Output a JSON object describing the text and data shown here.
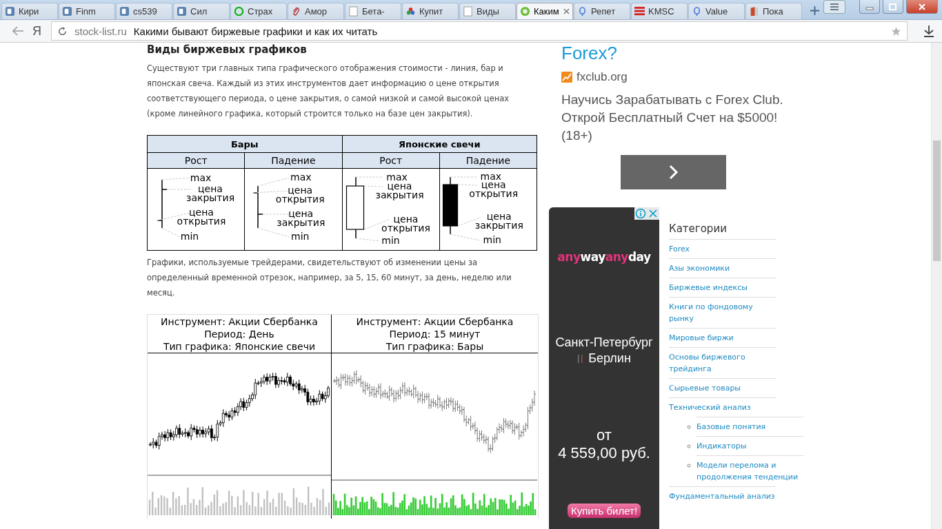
{
  "browser": {
    "tabs": [
      {
        "title": "Кири",
        "kind": "square",
        "selected": false
      },
      {
        "title": "Finm",
        "kind": "square",
        "selected": false
      },
      {
        "title": "cs539",
        "kind": "square",
        "selected": false
      },
      {
        "title": "Сил",
        "kind": "square",
        "selected": false
      },
      {
        "title": "Страх",
        "kind": "dollar",
        "selected": false
      },
      {
        "title": "Амор",
        "kind": "clip",
        "selected": false
      },
      {
        "title": "Бета-",
        "kind": "page",
        "selected": false
      },
      {
        "title": "Купит",
        "kind": "dots",
        "selected": false
      },
      {
        "title": "Виды",
        "kind": "page",
        "selected": false
      },
      {
        "title": "Каким",
        "kind": "coin",
        "selected": true
      },
      {
        "title": "Репет",
        "kind": "pin",
        "selected": false
      },
      {
        "title": "KMSC",
        "kind": "stripes",
        "selected": false
      },
      {
        "title": "Value",
        "kind": "pin",
        "selected": false
      },
      {
        "title": "Пока",
        "kind": "book",
        "selected": false
      }
    ],
    "logo": "Я",
    "address": {
      "domain": "stock-list.ru",
      "title": "Какими бывают биржевые графики и как их читать"
    }
  },
  "article": {
    "heading": "Виды биржевых графиков",
    "intro": "Существуют три главных типа графического отображения стоимости - линия, бар и японская свеча. Каждый из этих инструментов дает информацию о цене открытия соответствующего периода, о цене закрытия, о самой низкой и самой высокой ценах (кроме линейного графика, который строится только на базе цен закрытия).",
    "table": {
      "groups": [
        "Бары",
        "Японские свечи"
      ],
      "columns": [
        "Рост",
        "Падение",
        "Рост",
        "Падение"
      ],
      "cells": [
        {
          "kind": "bar-up",
          "labels": [
            {
              "kind": "max",
              "text": "max"
            },
            {
              "kind": "close",
              "text": "цена закрытия"
            },
            {
              "kind": "open",
              "text": "цена открытия"
            },
            {
              "kind": "min",
              "text": "min"
            }
          ]
        },
        {
          "kind": "bar-down",
          "labels": [
            {
              "kind": "max",
              "text": "max"
            },
            {
              "kind": "open",
              "text": "цена открытия"
            },
            {
              "kind": "close",
              "text": "цена закрытия"
            },
            {
              "kind": "min",
              "text": "min"
            }
          ]
        },
        {
          "kind": "candle-up",
          "labels": [
            {
              "kind": "max",
              "text": "max"
            },
            {
              "kind": "close",
              "text": "цена закрытия"
            },
            {
              "kind": "open",
              "text": "цена открытия"
            },
            {
              "kind": "min",
              "text": "min"
            }
          ]
        },
        {
          "kind": "candle-down",
          "labels": [
            {
              "kind": "max",
              "text": "max"
            },
            {
              "kind": "open",
              "text": "цена открытия"
            },
            {
              "kind": "close",
              "text": "цена закрытия"
            },
            {
              "kind": "min",
              "text": "min"
            }
          ]
        }
      ]
    },
    "outro": "Графики, используемые трейдерами, свидетельствуют об изменении цены за определенный временной отрезок, например, за 5, 15, 60 минут, за день, неделю или месяц.",
    "charts": [
      {
        "kind": "candles",
        "lines": [
          "Инструмент: Акции Сбербанка",
          "Период: День",
          "Тип графика: Японские свечи"
        ]
      },
      {
        "kind": "bars",
        "lines": [
          "Инструмент: Акции Сбербанка",
          "Период: 15 минут",
          "Тип графика: Бары"
        ]
      }
    ]
  },
  "ad_top": {
    "headline": "Forex?",
    "source": "fxclub.org",
    "text": "Научись Зарабатывать с Forex Club. Открой Бесплатный Счет на $5000! (18+)"
  },
  "ad_banner": {
    "logo": [
      {
        "text": "any",
        "color": "#e2347b"
      },
      {
        "text": "way",
        "color": "#ffffff"
      },
      {
        "text": "any",
        "color": "#e2347b"
      },
      {
        "text": "day",
        "color": "#ffffff"
      }
    ],
    "from_city": "Санкт-Петербург",
    "to_city": "Берлин",
    "price_prefix": "от",
    "price": "4 559,00 руб.",
    "button": "Купить билет!"
  },
  "categories": {
    "title": "Категории",
    "items": [
      {
        "label": "Forex"
      },
      {
        "label": "Азы экономики"
      },
      {
        "label": "Биржевые индексы"
      },
      {
        "label": "Книги по фондовому рынку"
      },
      {
        "label": "Мировые биржи"
      },
      {
        "label": "Основы биржевого трейдинга"
      },
      {
        "label": "Сырьевые товары"
      },
      {
        "label": "Технический анализ",
        "children": [
          {
            "label": "Базовые понятия"
          },
          {
            "label": "Индикаторы"
          },
          {
            "label": "Модели перелома и продолжения тенденции"
          }
        ]
      },
      {
        "label": "Фундаментальный анализ"
      }
    ]
  }
}
